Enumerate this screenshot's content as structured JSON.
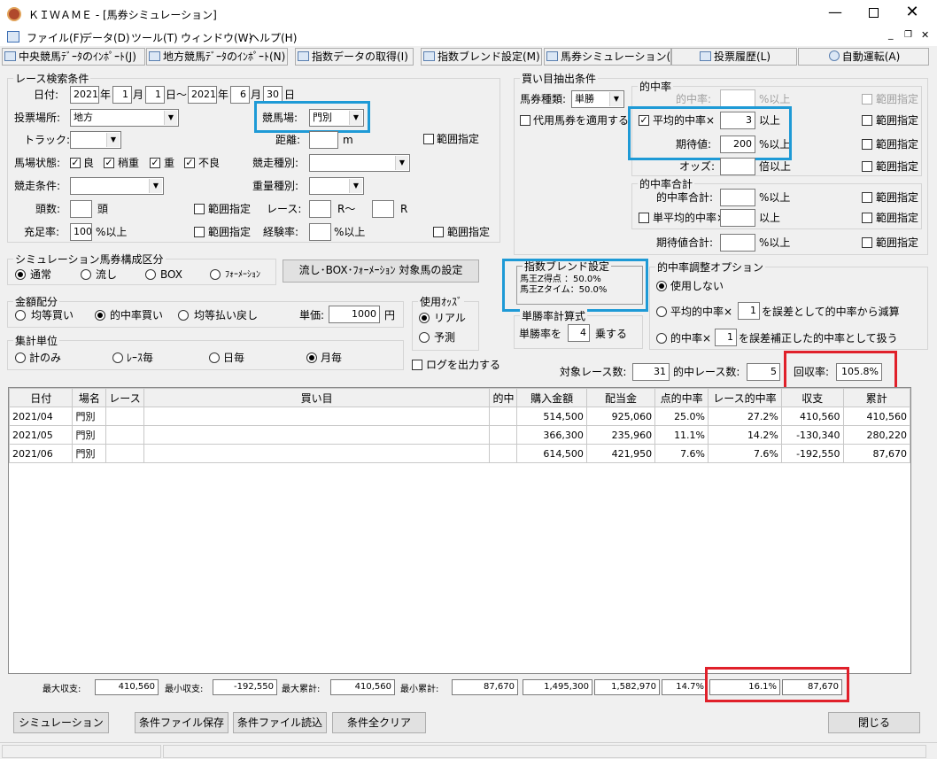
{
  "window": {
    "title": "ＫＩＷＡＭＥ - [馬券シミュレーション]"
  },
  "menu": [
    "ファイル(F)",
    "データ(D)",
    "ツール(T)",
    "ウィンドウ(W)",
    "ヘルプ(H)"
  ],
  "toolbar": [
    "中央競馬ﾃﾞｰﾀのｲﾝﾎﾟｰﾄ(J)",
    "地方競馬ﾃﾞｰﾀのｲﾝﾎﾟｰﾄ(N)",
    "指数データの取得(I)",
    "指数ブレンド設定(M)",
    "馬券シミュレーション(B)",
    "投票履歴(L)",
    "自動運転(A)"
  ],
  "race_search": {
    "title": "レース検索条件",
    "date_label": "日付:",
    "from": {
      "year": "2021",
      "month": "1",
      "day": "1"
    },
    "to": {
      "year": "2021",
      "month": "6",
      "day": "30"
    },
    "year_unit": "年",
    "month_unit": "月",
    "day_unit": "日",
    "range_sep": "～",
    "venue_type_label": "投票場所:",
    "venue_type": "地方",
    "track_name_label": "競馬場:",
    "track_name": "門別",
    "track_label": "トラック:",
    "distance_label": "距離:",
    "distance_unit": "m",
    "range_spec": "範囲指定",
    "condition_label": "馬場状態:",
    "conditions": [
      "良",
      "稍重",
      "重",
      "不良"
    ],
    "race_type_label": "競走種別:",
    "race_cond_label": "競走条件:",
    "weight_type_label": "重量種別:",
    "heads_label": "頭数:",
    "heads_unit": "頭",
    "race_label": "レース:",
    "race_unit": "R～",
    "race_unit2": "R",
    "fill_label": "充足率:",
    "fill_value": "100",
    "fill_unit": "%以上",
    "exp_label": "経験率:",
    "exp_unit": "%以上"
  },
  "bet_extract": {
    "title": "買い目抽出条件",
    "type_label": "馬券種類:",
    "type": "単勝",
    "substitute": "代用馬券を適用する",
    "hit_title": "的中率",
    "hit_rate_label": "的中率:",
    "pct_over": "%以上",
    "avg_hit_label": "平均的中率×",
    "avg_hit_value": "3",
    "over": "以上",
    "ev_label": "期待値:",
    "ev_value": "200",
    "odds_label": "オッズ:",
    "odds_unit": "倍以上",
    "sum_title": "的中率合計",
    "hit_sum_label": "的中率合計:",
    "single_avg_label": "単平均的中率×",
    "ev_sum_label": "期待値合計:",
    "range_spec": "範囲指定"
  },
  "sim_group": {
    "title": "シミュレーション馬券構成区分",
    "options": [
      "通常",
      "流し",
      "BOX",
      "ﾌｫｰﾒｰｼｮﾝ"
    ],
    "target_button": "流し･BOX･ﾌｫｰﾒｰｼｮﾝ 対象馬の設定"
  },
  "blend": {
    "title": "指数ブレンド設定",
    "line1": "馬王Z得点 ：50.0%",
    "line2": "馬王Zタイム：50.0%"
  },
  "adjust": {
    "title": "的中率調整オプション",
    "opt1": "使用しない",
    "opt2a": "平均的中率×",
    "opt2_value": "1",
    "opt2b": "を誤差として的中率から減算",
    "opt3a": "的中率×",
    "opt3_value": "1",
    "opt3b": "を誤差補正した的中率として扱う"
  },
  "allocation": {
    "title": "金額配分",
    "options": [
      "均等買い",
      "的中率買い",
      "均等払い戻し"
    ],
    "unit_label": "単価:",
    "unit_value": "1000",
    "yen": "円"
  },
  "odds_used": {
    "title": "使用ｵｯｽﾞ",
    "options": [
      "リアル",
      "予測"
    ]
  },
  "win_calc": {
    "title": "単勝率計算式",
    "prefix": "単勝率を",
    "value": "4",
    "suffix": "乗する"
  },
  "aggregate": {
    "title": "集計単位",
    "options": [
      "計のみ",
      "ﾚｰｽ毎",
      "日毎",
      "月毎"
    ]
  },
  "log_output": "ログを出力する",
  "stats": {
    "target_label": "対象レース数:",
    "target": "31",
    "hit_label": "的中レース数:",
    "hit": "5",
    "recovery_label": "回収率:",
    "recovery": "105.8%"
  },
  "table": {
    "headers": [
      "日付",
      "場名",
      "レース",
      "買い目",
      "的中",
      "購入金額",
      "配当金",
      "点的中率",
      "レース的中率",
      "収支",
      "累計"
    ],
    "rows": [
      [
        "2021/04",
        "門別",
        "",
        "",
        "",
        "514,500",
        "925,060",
        "25.0%",
        "27.2%",
        "410,560",
        "410,560"
      ],
      [
        "2021/05",
        "門別",
        "",
        "",
        "",
        "366,300",
        "235,960",
        "11.1%",
        "14.2%",
        "-130,340",
        "280,220"
      ],
      [
        "2021/06",
        "門別",
        "",
        "",
        "",
        "614,500",
        "421,950",
        "7.6%",
        "7.6%",
        "-192,550",
        "87,670"
      ]
    ]
  },
  "summary": {
    "max_income_label": "最大収支:",
    "max_income": "410,560",
    "min_income_label": "最小収支:",
    "min_income": "-192,550",
    "max_cum_label": "最大累計:",
    "max_cum": "410,560",
    "min_cum_label": "最小累計:",
    "min_cum": "87,670",
    "purchase": "1,495,300",
    "payout": "1,582,970",
    "point_rate": "14.7%",
    "race_rate": "16.1%",
    "total": "87,670"
  },
  "buttons": {
    "simulate": "シミュレーション",
    "save": "条件ファイル保存",
    "load": "条件ファイル読込",
    "clear": "条件全クリア",
    "close": "閉じる"
  }
}
